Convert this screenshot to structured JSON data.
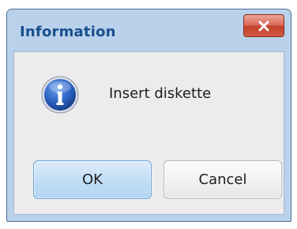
{
  "dialog": {
    "title": "Information",
    "message": "Insert diskette",
    "icon": "information-icon",
    "close_icon": "close-icon",
    "buttons": {
      "ok_label": "OK",
      "cancel_label": "Cancel"
    }
  },
  "colors": {
    "frame": "#b9d1ea",
    "title_text": "#1a4f8f",
    "close_button": "#c7432d",
    "client_background": "#ececec",
    "ok_button": "#c3def5",
    "cancel_button": "#f0f0f0"
  }
}
